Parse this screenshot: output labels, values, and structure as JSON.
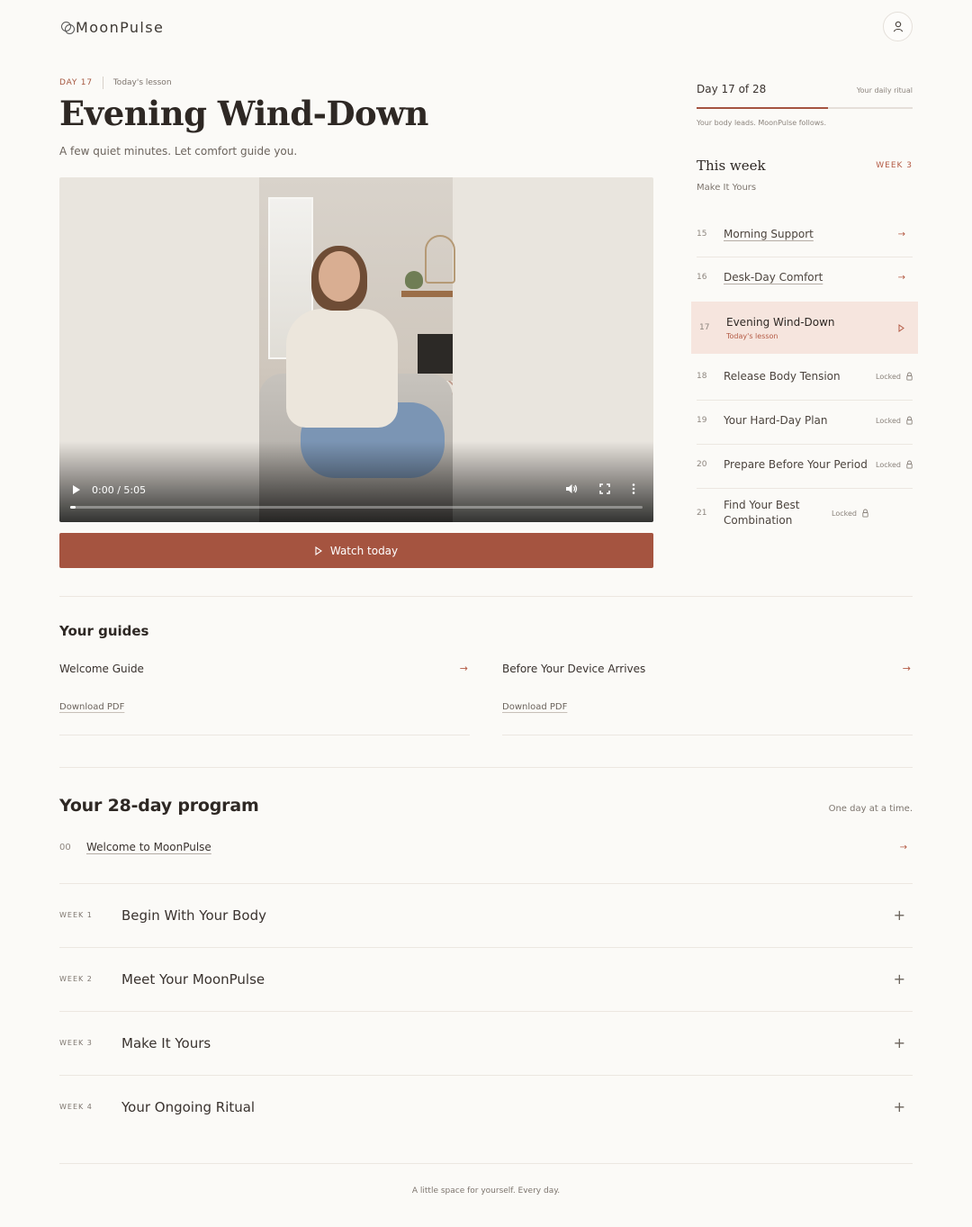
{
  "brand": {
    "name": "MoonPulse"
  },
  "lesson": {
    "day_label": "DAY 17",
    "today_label": "Today's lesson",
    "title": "Evening Wind-Down",
    "subtitle": "A few quiet minutes. Let comfort guide you."
  },
  "video": {
    "time": "0:00 / 5:05",
    "progress": 0.01
  },
  "watch_button": {
    "label": "Watch today"
  },
  "progress": {
    "count": "Day 17 of 28",
    "ritual": "Your daily ritual",
    "fraction": 0.607,
    "note": "Your body leads. MoonPulse follows."
  },
  "this_week": {
    "title": "This week",
    "week_label": "WEEK 3",
    "subtitle": "Make It Yours",
    "lessons": [
      {
        "num": "15",
        "name": "Morning Support"
      },
      {
        "num": "16",
        "name": "Desk-Day Comfort"
      },
      {
        "num": "17",
        "name": "Evening Wind-Down",
        "sub": "Today's lesson"
      },
      {
        "num": "18",
        "name": "Release Body Tension",
        "status": "Locked"
      },
      {
        "num": "19",
        "name": "Your Hard-Day Plan",
        "status": "Locked"
      },
      {
        "num": "20",
        "name": "Prepare Before Your Period",
        "status": "Locked"
      },
      {
        "num": "21",
        "name": "Find Your Best Combination",
        "status": "Locked"
      }
    ]
  },
  "guides": {
    "title": "Your guides",
    "items": [
      {
        "name": "Welcome Guide",
        "download": "Download PDF"
      },
      {
        "name": "Before Your Device Arrives",
        "download": "Download PDF"
      }
    ]
  },
  "program": {
    "title": "Your 28-day program",
    "tagline": "One day at a time.",
    "welcome": {
      "num": "00",
      "name": "Welcome to MoonPulse"
    },
    "weeks": [
      {
        "label": "WEEK 1",
        "name": "Begin With Your Body"
      },
      {
        "label": "WEEK 2",
        "name": "Meet Your MoonPulse"
      },
      {
        "label": "WEEK 3",
        "name": "Make It Yours"
      },
      {
        "label": "WEEK 4",
        "name": "Your Ongoing Ritual"
      }
    ]
  },
  "footer": {
    "text": "A little space for yourself. Every day."
  },
  "colors": {
    "accent": "#a55440",
    "background": "#fbfaf7",
    "active_row": "#f6e5de"
  }
}
